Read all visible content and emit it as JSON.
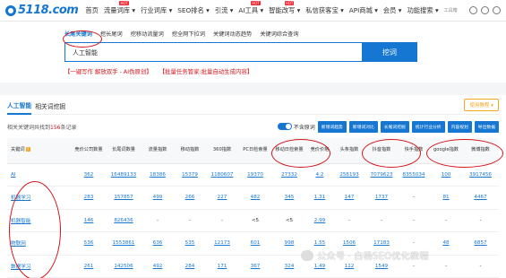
{
  "logo": {
    "text": "5118.com"
  },
  "nav": [
    {
      "label": "首页",
      "hot": ""
    },
    {
      "label": "流量词库 ▾",
      "hot": "HOT"
    },
    {
      "label": "行业词库 ▾",
      "hot": ""
    },
    {
      "label": "SEO排名 ▾",
      "hot": ""
    },
    {
      "label": "引流 ▾",
      "hot": ""
    },
    {
      "label": "AI工具 ▾",
      "hot": "HOT"
    },
    {
      "label": "智能改写 ▾",
      "hot": "HOT"
    },
    {
      "label": "私信获客宝 ▾",
      "hot": ""
    },
    {
      "label": "API商城 ▾",
      "hot": ""
    },
    {
      "label": "会员 ▾",
      "hot": ""
    },
    {
      "label": "功能搜索 ▾",
      "hot": ""
    },
    {
      "label": "工具箱",
      "hot": ""
    }
  ],
  "tabs": [
    "长尾关键词",
    "挖长尾词",
    "挖移动流量词",
    "挖全网下拉词",
    "关键词动态趋势",
    "关键词综合查询"
  ],
  "search": {
    "value": "人工智能",
    "button": "挖词"
  },
  "promo": {
    "left": "【一键写作 解放双手 - AI伪原创】",
    "right": "【批量任务管家:批量自动生成内容】"
  },
  "panel": {
    "title": "人工智能",
    "subtitle": "相关词挖掘",
    "use_button": "使用教程 ▾",
    "count_prefix": "相关关键词共找到",
    "count": "156",
    "count_suffix": "条记录",
    "toggle_label": "不含原词",
    "tool_buttons": [
      "新增词趋势",
      "新增词对比",
      "长尾词挖掘",
      "统计行业分析",
      "内容规划",
      "导出数据"
    ]
  },
  "table": {
    "headers": [
      "关键词",
      "竞价公司数量",
      "长尾词数量",
      "流量指数",
      "移动指数",
      "360指数",
      "PC日检索量",
      "移动日检索量",
      "竞价价格",
      "头条指数",
      "抖音指数",
      "快手指数",
      "google指数",
      "微博指数"
    ],
    "rows": [
      [
        "AI",
        "362",
        "16489133",
        "18386",
        "15379",
        "1180607",
        "19370",
        "27332",
        "4.2",
        "256193",
        "7079623",
        "8355034",
        "100",
        "3917456"
      ],
      [
        "机器学习",
        "283",
        "157857",
        "499",
        "266",
        "227",
        "482",
        "345",
        "1.31",
        "147",
        "1737",
        "-",
        "81",
        "4467"
      ],
      [
        "机器智能",
        "146",
        "826436",
        "-",
        "-",
        "-",
        "<5",
        "<5",
        "2.99",
        "-",
        "-",
        "-",
        "-",
        "-"
      ],
      [
        "物联网",
        "536",
        "1553861",
        "636",
        "535",
        "12173",
        "601",
        "998",
        "1.55",
        "1506",
        "17183",
        "-",
        "48",
        "6857"
      ],
      [
        "数据学习",
        "261",
        "142506",
        "492",
        "284",
        "171",
        "367",
        "324",
        "1.49",
        "112",
        "1549",
        "-",
        "-",
        "-"
      ]
    ]
  },
  "watermark": {
    "text": "公众号 · 白杨SEO优化教程"
  }
}
